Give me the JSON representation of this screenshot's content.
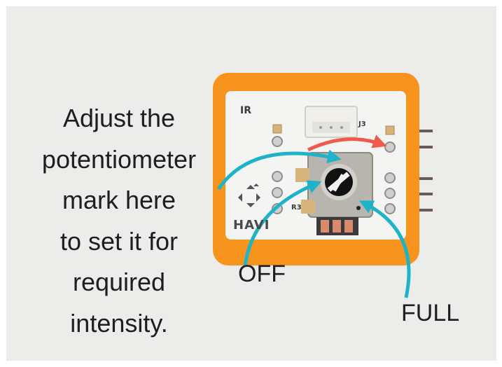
{
  "caption": {
    "lines": [
      "Adjust the",
      "potentiometer",
      "mark here",
      "to set it for",
      "required",
      "intensity."
    ]
  },
  "labels": {
    "off": "OFF",
    "full": "FULL"
  },
  "board": {
    "ir_label": "IR",
    "connector_label": "J3",
    "resistor_label": "R3",
    "logo_text": "HAVI"
  },
  "colors": {
    "frame": "#f7941d",
    "board": "#f4f4f2",
    "arrow_teal": "#1fb3c9",
    "arrow_red": "#ef5a4c",
    "background": "#ecedea"
  }
}
